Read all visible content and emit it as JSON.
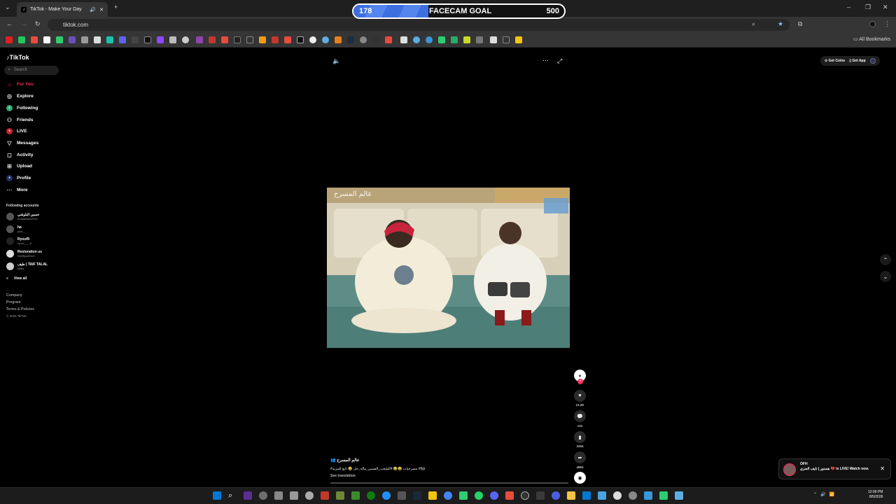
{
  "browser": {
    "tab_title": "TikTok - Make Your Day",
    "url": "tiktok.com",
    "all_bookmarks": "All Bookmarks"
  },
  "goal": {
    "current": "178",
    "label": "FACECAM GOAL",
    "target": "500",
    "progress": 0.356,
    "fill_color": "#3d6fe0"
  },
  "sidebar": {
    "logo": "TikTok",
    "search_placeholder": "Search",
    "nav": [
      {
        "label": "For You",
        "icon": "home-icon",
        "active": true
      },
      {
        "label": "Explore",
        "icon": "compass-icon"
      },
      {
        "label": "Following",
        "icon": "following-icon"
      },
      {
        "label": "Friends",
        "icon": "friends-icon"
      },
      {
        "label": "LIVE",
        "icon": "live-icon"
      },
      {
        "label": "Messages",
        "icon": "send-icon"
      },
      {
        "label": "Activity",
        "icon": "activity-icon"
      },
      {
        "label": "Upload",
        "icon": "plus-icon"
      },
      {
        "label": "Profile",
        "icon": "profile-icon"
      },
      {
        "label": "More",
        "icon": "more-icon"
      }
    ],
    "following_title": "Following accounts",
    "accounts": [
      {
        "name": "حسين البلوشي",
        "handle": "hussainaxx2022"
      },
      {
        "name": "ha",
        "handle": "yoel_"
      },
      {
        "name": "Ryoof9",
        "handle": "ryoof____9"
      },
      {
        "name": "Restoration us",
        "handle": "restfilgcenter1"
      },
      {
        "name": "طيف | TAIF TALAL",
        "handle": "taifffs"
      }
    ],
    "view_all": "View all",
    "footer": [
      "Company",
      "Program",
      "Terms & Policies",
      "© 2026 TikTok"
    ]
  },
  "video": {
    "overlay_text": "عالم المسرح",
    "author": "عالم المسرح",
    "caption": "#مسرحيات 😂😂 #الشعب_الصيني_ماله_حل 😂 تابع للمزيد #fyp",
    "see_translation": "See translation",
    "likes": "12.2K",
    "comments": "131",
    "saves": "3304",
    "shares": "4563"
  },
  "header_actions": {
    "get_coins": "Get Coins",
    "get_app": "Get App"
  },
  "notification": {
    "title": "OFH",
    "message": "هستور | نايف العنزي 💔 is LIVE! Watch now."
  },
  "taskbar": {
    "time": "12:06 PM",
    "date": "8/5/2026",
    "accent": "#0078d4"
  }
}
